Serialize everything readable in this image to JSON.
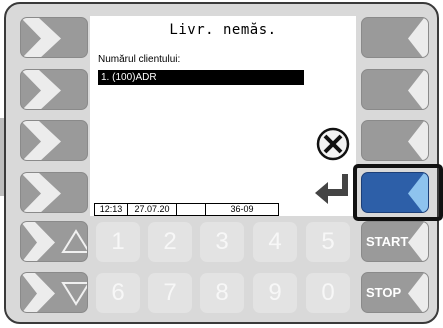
{
  "screen": {
    "title": "Livr. nemăs.",
    "customer_label": "Numărul clientului:",
    "selected_item": "1.  (100)ADR",
    "status": {
      "time": "12:13",
      "date": "27.07.20",
      "blank": "",
      "code": "36-09"
    }
  },
  "right_keys": {
    "start_label": "START",
    "stop_label": "STOP"
  },
  "keypad": {
    "row1": [
      "1",
      "2",
      "3",
      "4",
      "5"
    ],
    "row2": [
      "6",
      "7",
      "8",
      "9",
      "0"
    ]
  },
  "icons": {
    "cancel": "cancel-x-icon",
    "enter": "enter-arrow-icon",
    "up": "up-triangle-icon",
    "down": "down-triangle-icon",
    "soft_key_arrow": "chevron-arrow-icon"
  },
  "colors": {
    "active_key": "#2d5fa8",
    "active_key_tab": "#8ec3ee",
    "key_gray": "#9a9a9a",
    "frame": "#d9d9d9"
  }
}
